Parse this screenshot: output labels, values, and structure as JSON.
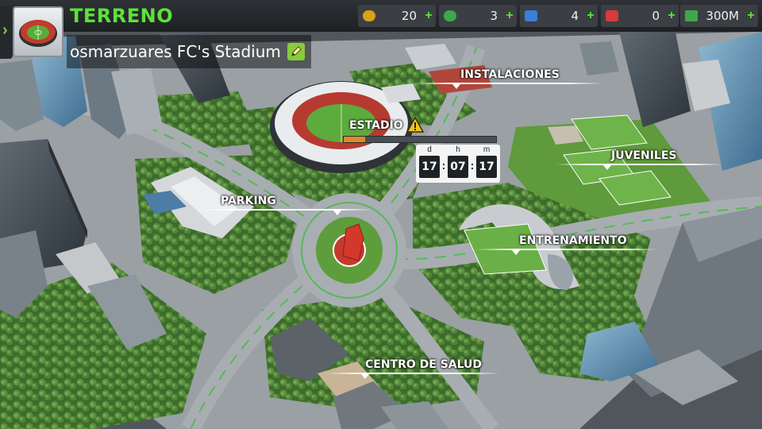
{
  "header": {
    "title": "TERRENO",
    "stadium_name": "osmarzuares FC's Stadium"
  },
  "resources": [
    {
      "name": "coins",
      "value": "20",
      "icon": "coin-icon",
      "color": "#d9a21b"
    },
    {
      "name": "training-tokens",
      "value": "3",
      "icon": "whistle-icon",
      "color": "#3ea84a"
    },
    {
      "name": "energy",
      "value": "4",
      "icon": "lightning-icon",
      "color": "#3a7fd8"
    },
    {
      "name": "health-packs",
      "value": "0",
      "icon": "medkit-icon",
      "color": "#d93a3a"
    },
    {
      "name": "money",
      "value": "300M",
      "icon": "cash-icon",
      "color": "#3ea84a"
    }
  ],
  "buildings": {
    "installaciones": "INSTALACIONES",
    "estadio": "ESTADIO",
    "juveniles": "JUVENILES",
    "parking": "PARKING",
    "entrenamiento": "ENTRENAMIENTO",
    "centro_salud": "CENTRO DE SALUD"
  },
  "estadio_progress": 0.14,
  "timer": {
    "days_label": "d",
    "hours_label": "h",
    "minutes_label": "m",
    "days": "17",
    "hours": "07",
    "minutes": "17"
  }
}
